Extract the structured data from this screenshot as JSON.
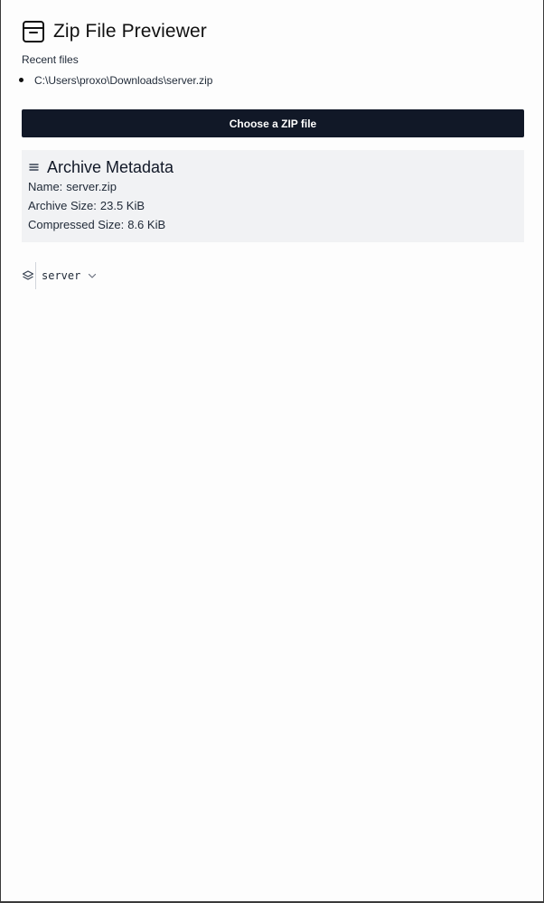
{
  "app": {
    "title": "Zip File Previewer",
    "icon": "archive-box-icon"
  },
  "recent": {
    "label": "Recent files",
    "items": [
      "C:\\Users\\proxo\\Downloads\\server.zip"
    ]
  },
  "choose_button": {
    "label": "Choose a ZIP file"
  },
  "metadata": {
    "title": "Archive Metadata",
    "icon": "menu-lines-icon",
    "name_label": "Name:",
    "name_value": "server.zip",
    "archive_size_label": "Archive Size:",
    "archive_size_value": "23.5 KiB",
    "compressed_size_label": "Compressed Size:",
    "compressed_size_value": "8.6 KiB"
  },
  "tree": {
    "root_icon": "layers-icon",
    "root_label": "server",
    "expand_icon": "chevron-down-icon"
  },
  "colors": {
    "button_bg": "#111827",
    "button_text": "#ffffff",
    "panel_bg": "#f1f2f4",
    "page_bg": "#fdfdfd"
  }
}
